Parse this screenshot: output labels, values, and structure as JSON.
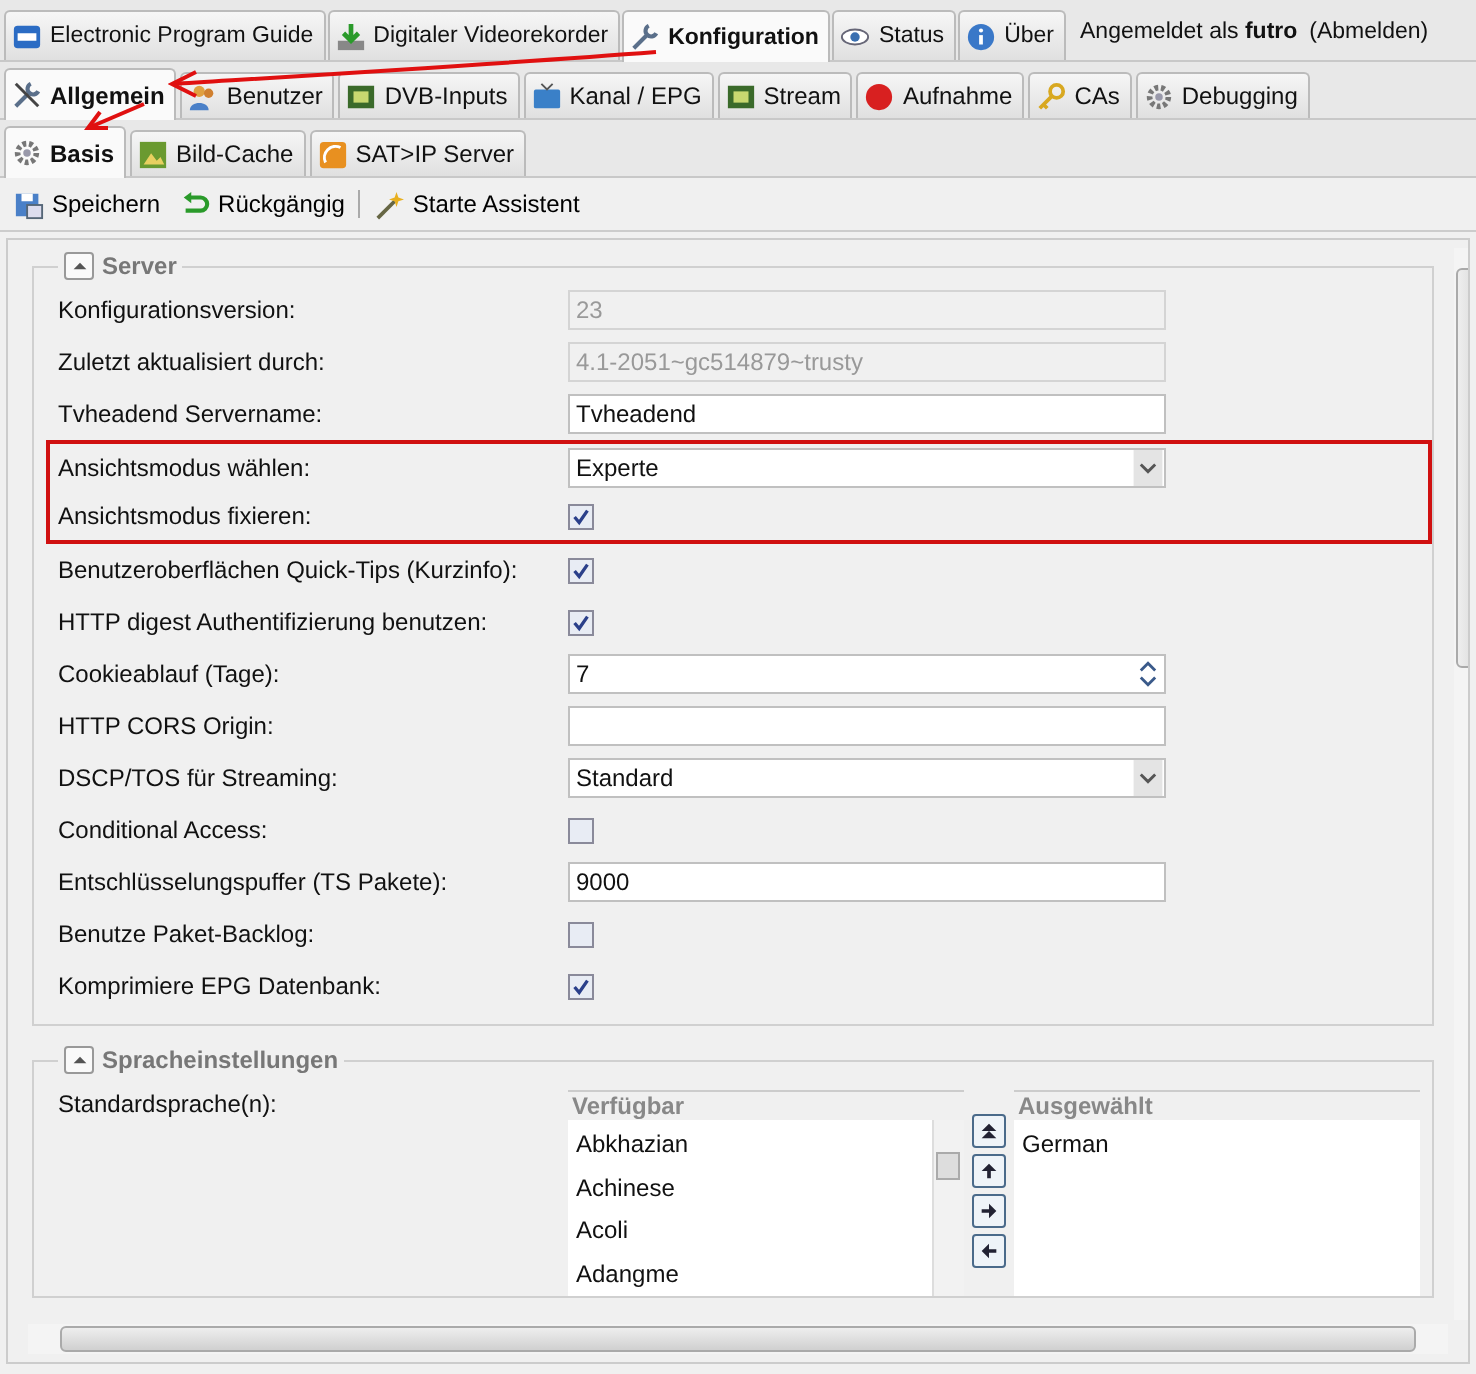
{
  "main_tabs": [
    {
      "label": "Electronic Program Guide",
      "selected": false
    },
    {
      "label": "Digitaler Videorekorder",
      "selected": false
    },
    {
      "label": "Konfiguration",
      "selected": true
    },
    {
      "label": "Status",
      "selected": false
    },
    {
      "label": "Über",
      "selected": false
    }
  ],
  "login": {
    "prefix": "Angemeldet als",
    "user": "futro",
    "logout": "(Abmelden)"
  },
  "config_tabs": [
    {
      "label": "Allgemein",
      "selected": true
    },
    {
      "label": "Benutzer",
      "selected": false
    },
    {
      "label": "DVB-Inputs",
      "selected": false
    },
    {
      "label": "Kanal / EPG",
      "selected": false
    },
    {
      "label": "Stream",
      "selected": false
    },
    {
      "label": "Aufnahme",
      "selected": false
    },
    {
      "label": "CAs",
      "selected": false
    },
    {
      "label": "Debugging",
      "selected": false
    }
  ],
  "sub_tabs": [
    {
      "label": "Basis",
      "selected": true
    },
    {
      "label": "Bild-Cache",
      "selected": false
    },
    {
      "label": "SAT>IP Server",
      "selected": false
    }
  ],
  "toolbar": [
    "Speichern",
    "Rückgängig",
    "Starte Assistent"
  ],
  "server": {
    "title": "Server",
    "fields": [
      {
        "kind": "text",
        "label": "Konfigurationsversion:",
        "value": "23",
        "disabled": true,
        "highlighted": false
      },
      {
        "kind": "text",
        "label": "Zuletzt aktualisiert durch:",
        "value": "4.1-2051~gc514879~trusty",
        "disabled": true,
        "highlighted": false
      },
      {
        "kind": "text",
        "label": "Tvheadend Servername:",
        "value": "Tvheadend",
        "disabled": false,
        "highlighted": false
      },
      {
        "kind": "select",
        "label": "Ansichtsmodus wählen:",
        "value": "Experte",
        "highlighted": true
      },
      {
        "kind": "checkbox",
        "label": "Ansichtsmodus fixieren:",
        "checked": true,
        "highlighted": true
      },
      {
        "kind": "checkbox",
        "label": "Benutzeroberflächen Quick-Tips (Kurzinfo):",
        "checked": true,
        "highlighted": false
      },
      {
        "kind": "checkbox",
        "label": "HTTP digest Authentifizierung benutzen:",
        "checked": true,
        "highlighted": false
      },
      {
        "kind": "number",
        "label": "Cookieablauf (Tage):",
        "value": "7",
        "highlighted": false
      },
      {
        "kind": "text",
        "label": "HTTP CORS Origin:",
        "disabled": false,
        "highlighted": false
      },
      {
        "kind": "select",
        "label": "DSCP/TOS für Streaming:",
        "value": "Standard",
        "highlighted": false
      },
      {
        "kind": "checkbox",
        "label": "Conditional Access:",
        "checked": false,
        "highlighted": false
      },
      {
        "kind": "text",
        "label": "Entschlüsselungspuffer (TS Pakete):",
        "value": "9000",
        "disabled": false,
        "highlighted": false
      },
      {
        "kind": "checkbox",
        "label": "Benutze Paket-Backlog:",
        "checked": false,
        "highlighted": false
      },
      {
        "kind": "checkbox",
        "label": "Komprimiere EPG Datenbank:",
        "checked": true,
        "highlighted": false
      }
    ]
  },
  "language": {
    "title": "Spracheinstellungen",
    "label": "Standardsprache(n):",
    "available_title": "Verfügbar",
    "available": [
      "Abkhazian",
      "Achinese",
      "Acoli",
      "Adangme"
    ],
    "selected_title": "Ausgewählt",
    "selected": [
      "German"
    ]
  }
}
